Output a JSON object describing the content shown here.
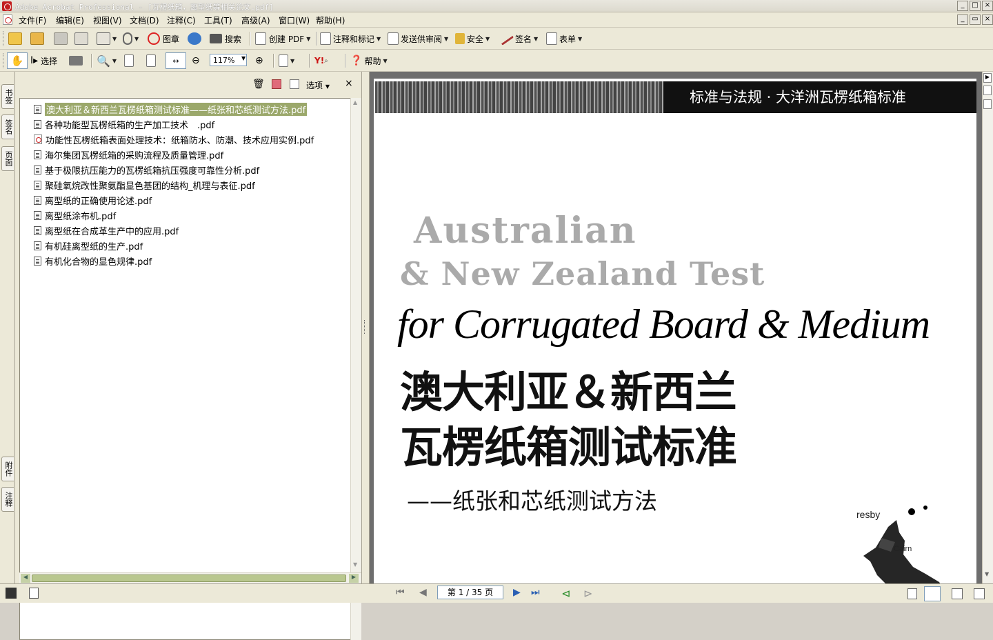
{
  "window": {
    "title": "Adobe Acrobat Professional - [瓦楞纸箱，离型纸等相关论文.pdf]"
  },
  "menu": [
    "文件(F)",
    "编辑(E)",
    "视图(V)",
    "文档(D)",
    "注释(C)",
    "工具(T)",
    "高级(A)",
    "窗口(W)",
    "帮助(H)"
  ],
  "toolbar1": {
    "stamp_label": "图章",
    "search_label": "搜索",
    "create_pdf_label": "创建 PDF",
    "comment_label": "注释和标记",
    "send_review_label": "发送供审阅",
    "secure_label": "安全",
    "sign_label": "签名",
    "forms_label": "表单"
  },
  "toolbar2": {
    "select_label": "选择",
    "zoom_value": "117%",
    "help_label": "帮助"
  },
  "side_tabs": [
    "书签",
    "签名",
    "页面",
    "附件",
    "注释"
  ],
  "bookmarks": {
    "options_label": "选项",
    "items": [
      {
        "label": "澳大利亚＆新西兰瓦楞纸箱测试标准——纸张和芯纸测试方法.pdf",
        "icon": "page-icon",
        "selected": true
      },
      {
        "label": "各种功能型瓦楞纸箱的生产加工技术　.pdf",
        "icon": "page-icon"
      },
      {
        "label": "功能性瓦楞纸箱表面处理技术：纸箱防水、防潮、技术应用实例.pdf",
        "icon": "pdf-icon"
      },
      {
        "label": "海尔集团瓦楞纸箱的采购流程及质量管理.pdf",
        "icon": "page-icon"
      },
      {
        "label": "基于极限抗压能力的瓦楞纸箱抗压强度可靠性分析.pdf",
        "icon": "page-icon"
      },
      {
        "label": "聚硅氧烷改性聚氨酯显色基团的结构_机理与表征.pdf",
        "icon": "page-icon"
      },
      {
        "label": "离型纸的正确使用论述.pdf",
        "icon": "page-icon"
      },
      {
        "label": "离型纸涂布机.pdf",
        "icon": "page-icon"
      },
      {
        "label": "离型纸在合成革生产中的应用.pdf",
        "icon": "page-icon"
      },
      {
        "label": "有机硅离型纸的生产.pdf",
        "icon": "page-icon"
      },
      {
        "label": "有机化合物的显色规律.pdf",
        "icon": "page-icon"
      }
    ]
  },
  "document": {
    "header_band": "标准与法规 · 大洋洲瓦楞纸箱标准",
    "english_line1": "Australian",
    "english_line2": "& New Zealand Test",
    "english_line3": "for Corrugated Board & Medium",
    "chinese_title_1": "澳大利亚＆新西兰",
    "chinese_title_2": "瓦楞纸箱测试标准",
    "subtitle": "——纸张和芯纸测试方法",
    "map_label_1": "resby",
    "map_label_2": "Cairn"
  },
  "status": {
    "page_indicator": "第 1 / 35 页"
  }
}
